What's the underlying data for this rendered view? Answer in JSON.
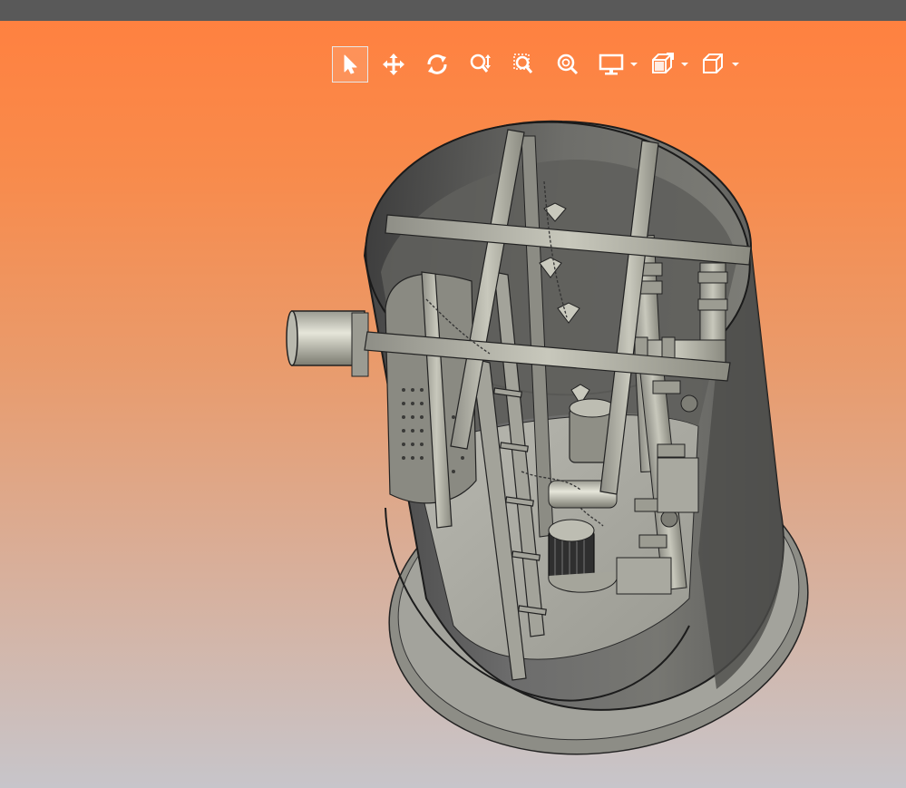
{
  "app": {
    "colors": {
      "title_bar": "#595959",
      "viewport_top": "#ff8140",
      "viewport_bottom": "#c7c5ca",
      "toolbar_icon": "#ffffff"
    }
  },
  "toolbar": {
    "tools": [
      {
        "name": "select-tool",
        "icon": "cursor-arrow-icon",
        "active": true
      },
      {
        "name": "pan-tool",
        "icon": "move-arrows-icon",
        "active": false
      },
      {
        "name": "rotate-tool",
        "icon": "rotate-icon",
        "active": false
      },
      {
        "name": "zoom-tool",
        "icon": "zoom-icon",
        "active": false
      },
      {
        "name": "zoom-window-tool",
        "icon": "zoom-window-icon",
        "active": false
      },
      {
        "name": "zoom-fit-tool",
        "icon": "zoom-fit-icon",
        "active": false
      }
    ],
    "dropdowns": [
      {
        "name": "display-mode-dropdown",
        "icon": "monitor-icon"
      },
      {
        "name": "section-view-dropdown",
        "icon": "section-plane-icon"
      },
      {
        "name": "view-orientation-dropdown",
        "icon": "cube-icon"
      }
    ]
  },
  "model": {
    "subject": "3d-model-pump-station-tank"
  }
}
